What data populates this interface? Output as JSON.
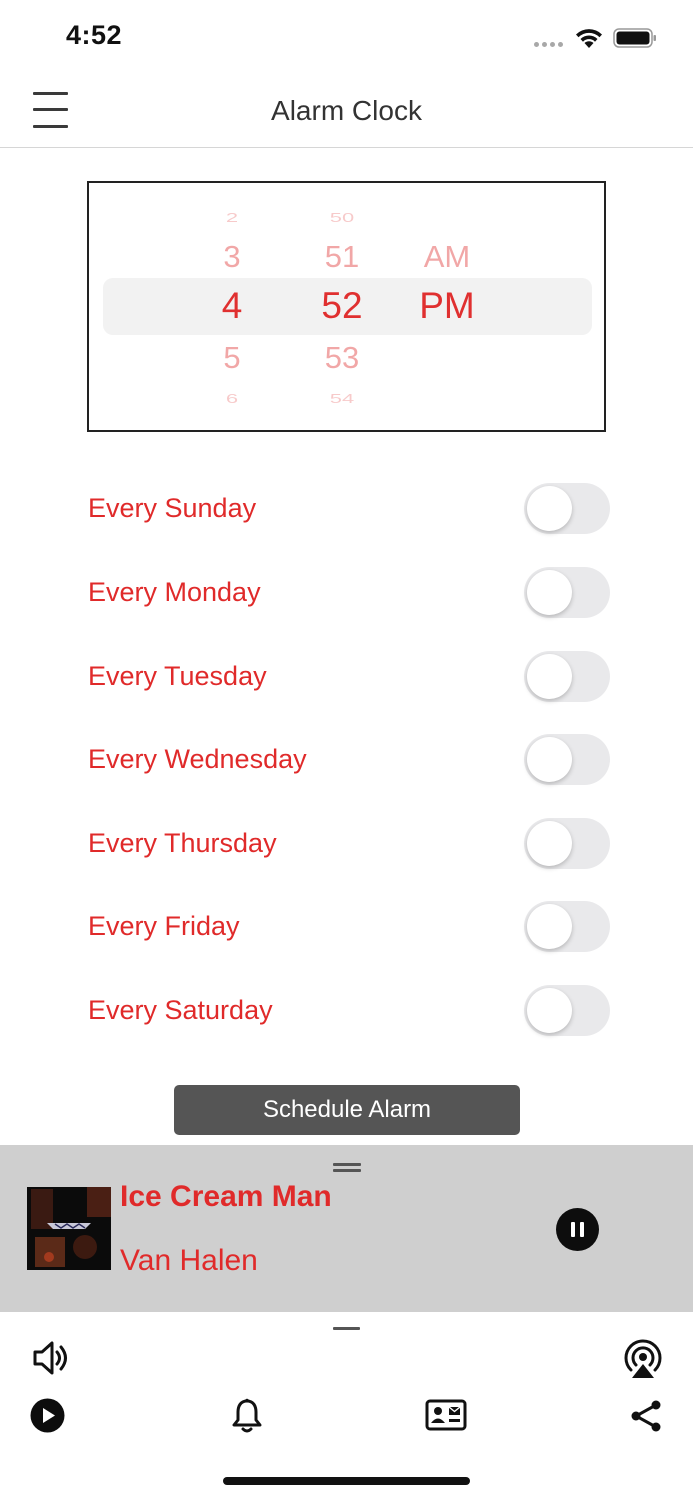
{
  "status_bar": {
    "time": "4:52"
  },
  "nav": {
    "title": "Alarm Clock"
  },
  "picker": {
    "hours": {
      "far_above": "2",
      "above": "3",
      "selected": "4",
      "below": "5",
      "far_below": "6"
    },
    "minutes": {
      "far_above": "50",
      "above": "51",
      "selected": "52",
      "below": "53",
      "far_below": "54"
    },
    "period": {
      "above": "AM",
      "selected": "PM"
    },
    "accent_color": "#e03030"
  },
  "days": [
    {
      "label": "Every Sunday",
      "enabled": false
    },
    {
      "label": "Every Monday",
      "enabled": false
    },
    {
      "label": "Every Tuesday",
      "enabled": false
    },
    {
      "label": "Every Wednesday",
      "enabled": false
    },
    {
      "label": "Every Thursday",
      "enabled": false
    },
    {
      "label": "Every Friday",
      "enabled": false
    },
    {
      "label": "Every Saturday",
      "enabled": false
    }
  ],
  "schedule_button": {
    "label": "Schedule Alarm"
  },
  "now_playing": {
    "title": "Ice Cream Man",
    "artist": "Van Halen",
    "state": "playing",
    "album_art_icon": "album-cover"
  },
  "toolbar": {
    "icons": [
      "volume-icon",
      "airplay-icon",
      "play-icon",
      "bell-icon",
      "contact-card-icon",
      "share-icon"
    ]
  },
  "colors": {
    "accent": "#e02a2a",
    "button": "#555555",
    "player_bg": "#cfcfcf",
    "toggle_off": "#e9e9eb"
  }
}
